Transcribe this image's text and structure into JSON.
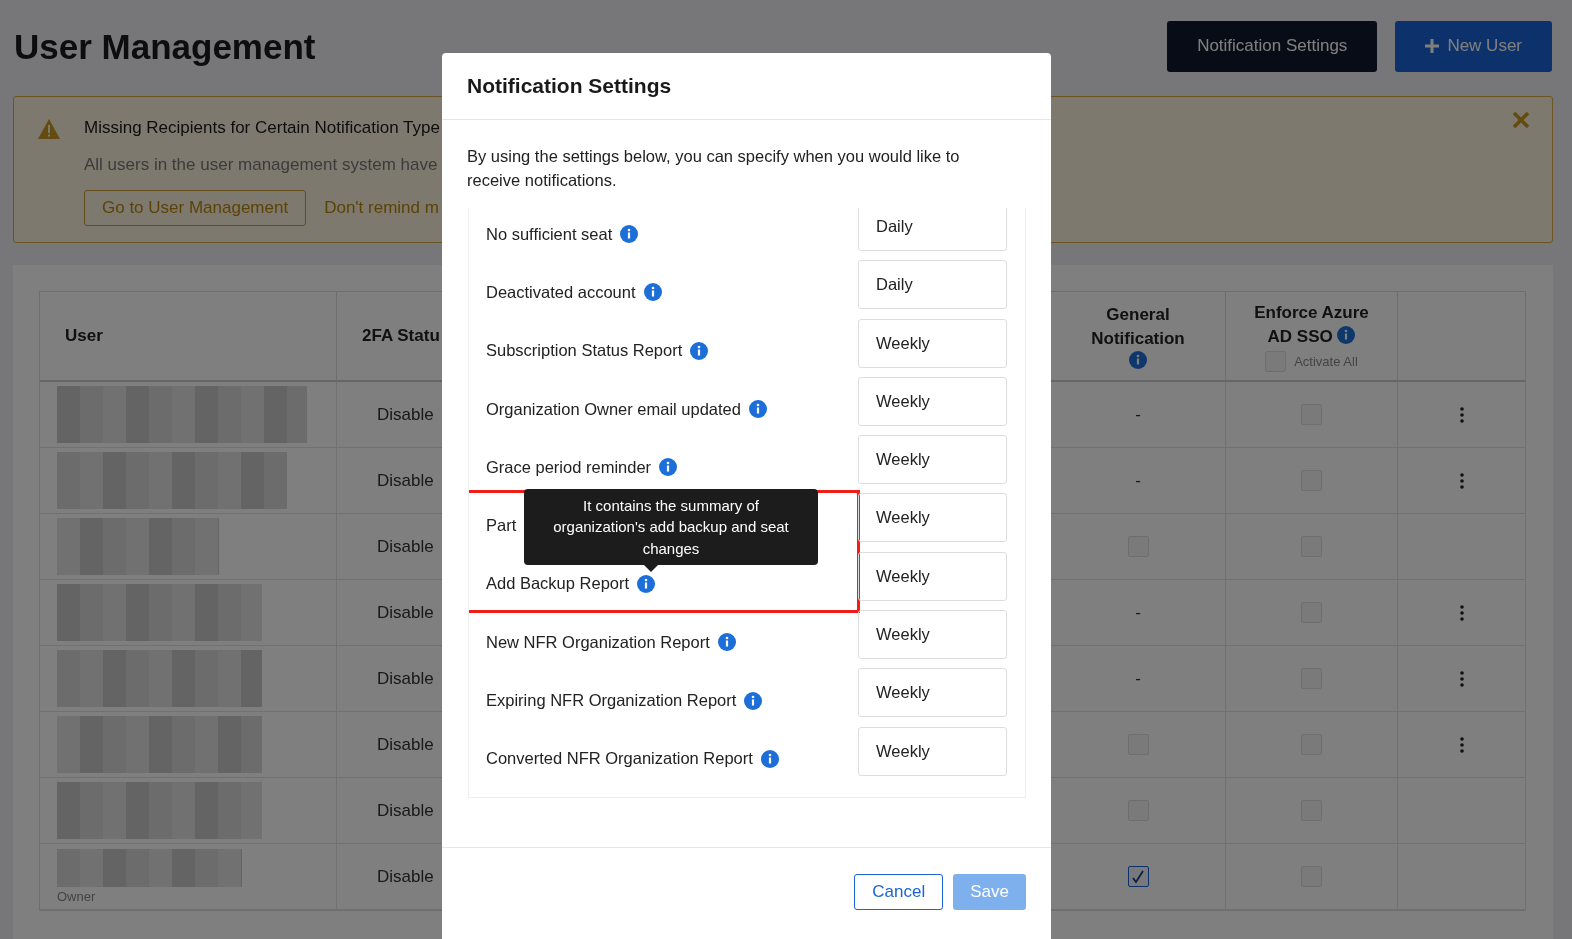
{
  "page": {
    "title": "User Management",
    "buttons": [
      {
        "label": "Notification Settings",
        "kind": "dark"
      },
      {
        "label": "New User",
        "kind": "primary"
      }
    ]
  },
  "banner": {
    "title": "Missing Recipients for Certain Notification Type",
    "message": "All users in the user management system have",
    "actions": [
      {
        "label": "Go to User Management",
        "kind": "outline"
      },
      {
        "label": "Don't remind m",
        "kind": "link"
      }
    ]
  },
  "table": {
    "columns": [
      {
        "label": "User",
        "info": false
      },
      {
        "label": "2FA Statu",
        "info": false
      },
      {
        "label": "General Notification",
        "info": true
      },
      {
        "label": "Enforce Azure AD SSO",
        "info": true
      }
    ],
    "activate_all": {
      "label": "Activate All",
      "checked": false
    },
    "rows": [
      {
        "two_fa": "Disable",
        "general": {
          "kind": "dash",
          "text": "-"
        },
        "azure_checked": false,
        "menu": true
      },
      {
        "two_fa": "Disable",
        "general": {
          "kind": "dash",
          "text": "-"
        },
        "azure_checked": false,
        "menu": true
      },
      {
        "two_fa": "Disable",
        "general": {
          "kind": "checkbox",
          "checked": false
        },
        "azure_checked": false,
        "menu": false
      },
      {
        "two_fa": "Disable",
        "general": {
          "kind": "dash",
          "text": "-"
        },
        "azure_checked": false,
        "menu": true
      },
      {
        "two_fa": "Disable",
        "general": {
          "kind": "dash",
          "text": "-"
        },
        "azure_checked": false,
        "menu": true
      },
      {
        "two_fa": "Disable",
        "general": {
          "kind": "checkbox",
          "checked": false
        },
        "azure_checked": false,
        "menu": true
      },
      {
        "two_fa": "Disable",
        "general": {
          "kind": "checkbox",
          "checked": false
        },
        "azure_checked": false,
        "menu": false
      },
      {
        "two_fa": "Disable",
        "role": "Owner",
        "general": {
          "kind": "checkbox",
          "checked": true
        },
        "azure_checked": false,
        "menu": false
      }
    ]
  },
  "modal": {
    "title": "Notification Settings",
    "intro": "By using the settings below, you can specify when you would like to receive notifications.",
    "settings": [
      {
        "label": "No sufficient seat",
        "info": true,
        "frequency": "Daily",
        "highlighted": false
      },
      {
        "label": "Deactivated account",
        "info": true,
        "frequency": "Daily",
        "highlighted": false
      },
      {
        "label": "Subscription Status Report",
        "info": true,
        "frequency": "Weekly",
        "highlighted": false
      },
      {
        "label": "Organization Owner email updated",
        "info": true,
        "frequency": "Weekly",
        "highlighted": false
      },
      {
        "label": "Grace period reminder",
        "info": true,
        "frequency": "Weekly",
        "highlighted": false
      },
      {
        "label": "Part",
        "info": false,
        "frequency": "Weekly",
        "highlighted": true
      },
      {
        "label": "Add Backup Report",
        "info": true,
        "frequency": "Weekly",
        "highlighted": true,
        "tooltip": "It contains the summary of organization's add backup and seat changes"
      },
      {
        "label": "New NFR Organization Report",
        "info": true,
        "frequency": "Weekly",
        "highlighted": false
      },
      {
        "label": "Expiring NFR Organization Report",
        "info": true,
        "frequency": "Weekly",
        "highlighted": false
      },
      {
        "label": "Converted NFR Organization Report",
        "info": true,
        "frequency": "Weekly",
        "highlighted": false
      }
    ],
    "buttons": [
      {
        "label": "Cancel",
        "kind": "outline",
        "disabled": false
      },
      {
        "label": "Save",
        "kind": "primary",
        "disabled": true
      }
    ]
  }
}
